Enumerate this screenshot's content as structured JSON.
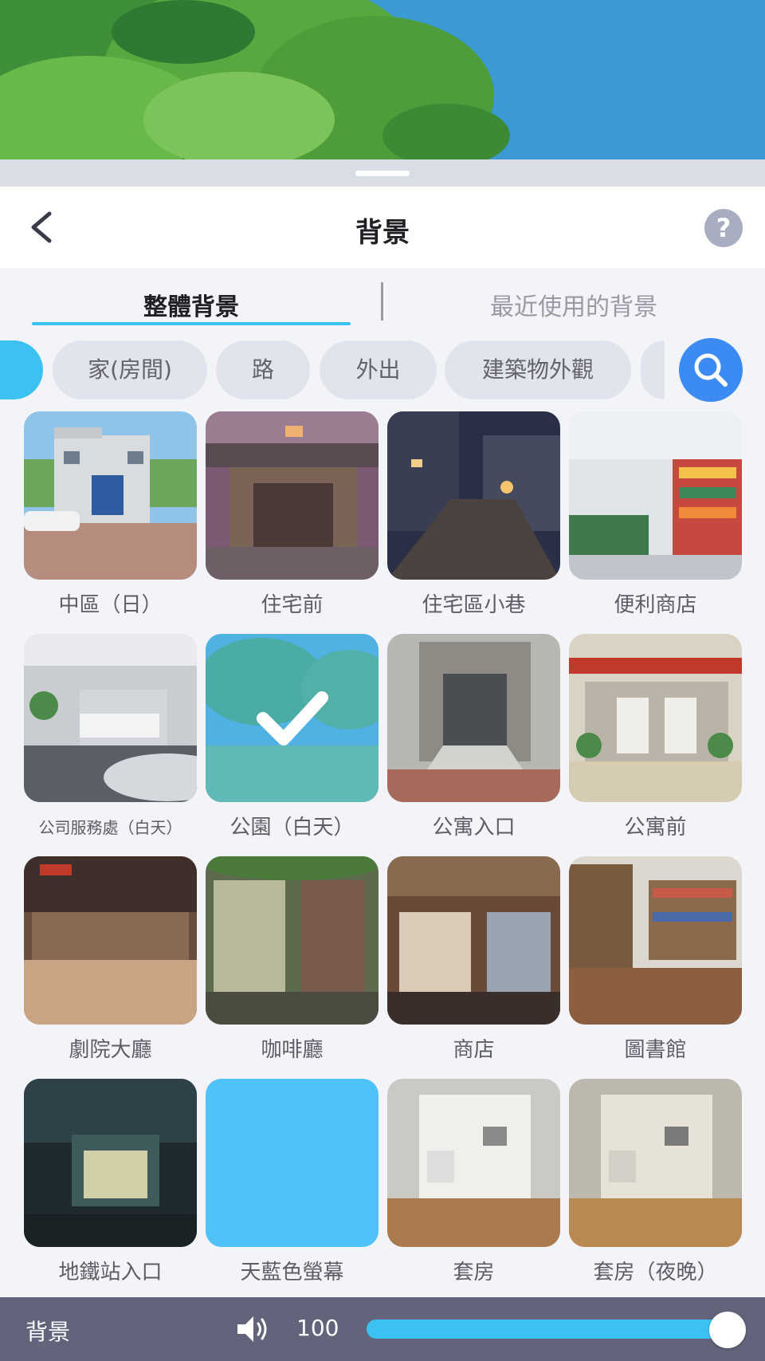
{
  "header": {
    "title": "背景"
  },
  "tabs": [
    {
      "label": "整體背景",
      "active": true
    },
    {
      "label": "最近使用的背景",
      "active": false
    }
  ],
  "categories": [
    {
      "label": "家(房間)"
    },
    {
      "label": "路"
    },
    {
      "label": "外出"
    },
    {
      "label": "建築物外觀"
    }
  ],
  "backgrounds": [
    {
      "label": "中區（日）",
      "thumb": "police-station"
    },
    {
      "label": "住宅前",
      "thumb": "house-front"
    },
    {
      "label": "住宅區小巷",
      "thumb": "night-alley"
    },
    {
      "label": "便利商店",
      "thumb": "convenience-store"
    },
    {
      "label": "公司服務處（白天）",
      "thumb": "office-lobby"
    },
    {
      "label": "公園（白天）",
      "thumb": "park",
      "selected": true
    },
    {
      "label": "公寓入口",
      "thumb": "apartment-entrance"
    },
    {
      "label": "公寓前",
      "thumb": "apartment-front"
    },
    {
      "label": "劇院大廳",
      "thumb": "theater-lobby"
    },
    {
      "label": "咖啡廳",
      "thumb": "cafe"
    },
    {
      "label": "商店",
      "thumb": "shop"
    },
    {
      "label": "圖書館",
      "thumb": "library"
    },
    {
      "label": "地鐵站入口",
      "thumb": "subway-entrance"
    },
    {
      "label": "天藍色螢幕",
      "thumb": "sky-blue-screen"
    },
    {
      "label": "套房",
      "thumb": "studio-room"
    },
    {
      "label": "套房（夜晚）",
      "thumb": "studio-room-night"
    }
  ],
  "audio": {
    "label": "背景",
    "volume": "100",
    "volume_fraction": 1.0
  },
  "colors": {
    "accent": "#3cc2f2",
    "search": "#3b8bf3",
    "bottom_bar": "#62647c",
    "sky_blue_screen": "#4fc3f7"
  },
  "icons": {
    "back": "chevron-left-icon",
    "help": "question-icon",
    "search": "search-icon",
    "volume": "speaker-icon",
    "selected": "checkmark-icon"
  }
}
